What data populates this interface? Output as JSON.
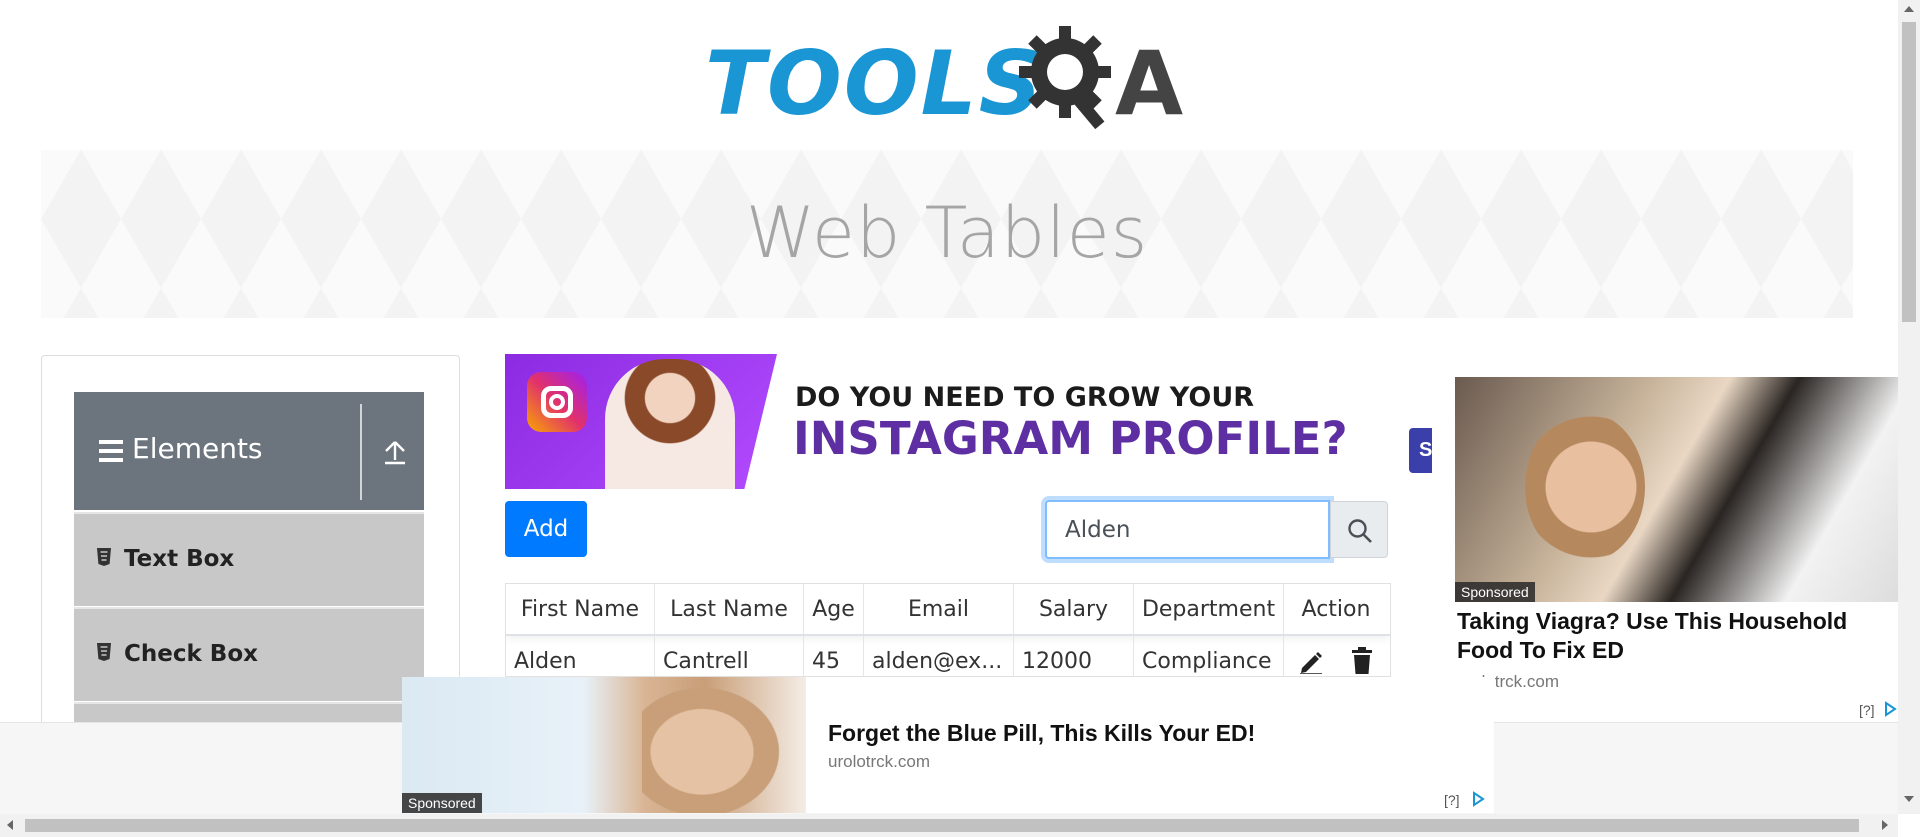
{
  "logo": {
    "text": "TOOLS",
    "suffix": "A"
  },
  "banner": {
    "title": "Web Tables"
  },
  "sidebar": {
    "group_title": "Elements",
    "items": [
      {
        "label": "Text Box"
      },
      {
        "label": "Check Box"
      }
    ]
  },
  "instagram_ad": {
    "line1": "DO YOU NEED TO GROW YOUR",
    "line2": "INSTAGRAM PROFILE?",
    "peek_text": "S"
  },
  "toolbar": {
    "add_label": "Add",
    "search_value": "Alden"
  },
  "table": {
    "headers": [
      "First Name",
      "Last Name",
      "Age",
      "Email",
      "Salary",
      "Department",
      "Action"
    ],
    "rows": [
      {
        "first": "Alden",
        "last": "Cantrell",
        "age": "45",
        "email": "alden@ex...",
        "salary": "12000",
        "department": "Compliance"
      }
    ]
  },
  "right_ad": {
    "sponsored": "Sponsored",
    "headline": "Taking Viagra? Use This Household Food To Fix ED",
    "domain": "urolotrck.com",
    "help": "[?]"
  },
  "bottom_ad": {
    "sponsored": "Sponsored",
    "headline": "Forget the Blue Pill, This Kills Your ED!",
    "domain": "urolotrck.com",
    "help": "[?]"
  },
  "colors": {
    "primary": "#007bff",
    "logo_blue": "#1a96d4",
    "sidebar_header": "#6c757d",
    "sidebar_item": "#c8c8c8"
  }
}
